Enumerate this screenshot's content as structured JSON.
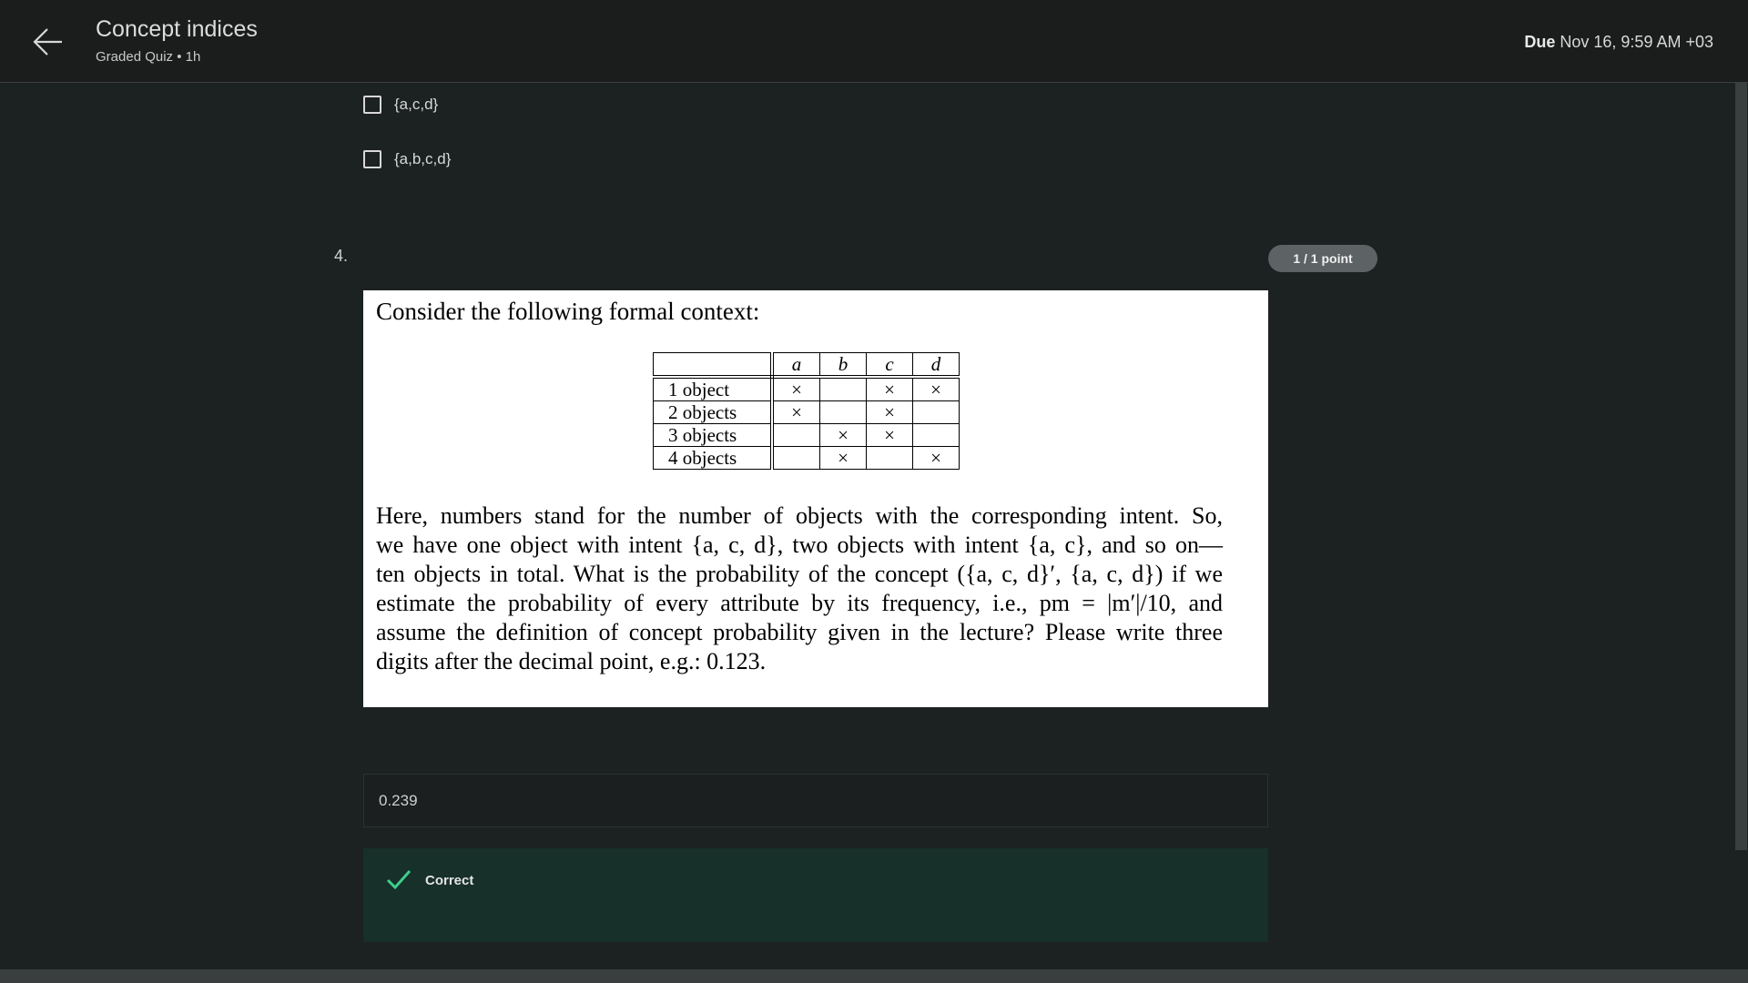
{
  "header": {
    "title": "Concept indices",
    "subtitle": "Graded Quiz • 1h",
    "due_label": "Due",
    "due_value": "Nov 16, 9:59 AM +03"
  },
  "prev_question": {
    "options": [
      {
        "label": "{a,c,d}",
        "checked": false
      },
      {
        "label": "{a,b,c,d}",
        "checked": false
      }
    ]
  },
  "question": {
    "number": "4.",
    "points": "1 / 1 point",
    "intro": "Consider the following formal context:",
    "table": {
      "columns": [
        "a",
        "b",
        "c",
        "d"
      ],
      "rows": [
        {
          "label": "1 object",
          "cells": [
            "×",
            "",
            "×",
            "×"
          ]
        },
        {
          "label": "2 objects",
          "cells": [
            "×",
            "",
            "×",
            ""
          ]
        },
        {
          "label": "3 objects",
          "cells": [
            "",
            "×",
            "×",
            ""
          ]
        },
        {
          "label": "4 objects",
          "cells": [
            "",
            "×",
            "",
            "×"
          ]
        }
      ]
    },
    "body_lines": [
      "Here, numbers stand for the number of objects with the corresponding intent. So,",
      "we have one object with intent {a, c, d}, two objects with intent {a, c}, and so on—",
      "ten objects in total. What is the probability of the concept ({a, c, d}′, {a, c, d}) if we",
      "estimate the probability of every attribute by its frequency, i.e., pm = |m′|/10, and",
      "assume the definition of concept probability given in the lecture? Please write three",
      "digits after the decimal point, e.g.: 0.123."
    ],
    "answer": "0.239",
    "feedback": "Correct"
  },
  "colors": {
    "background": "#1c2121",
    "header_bg": "#1b1d1d",
    "badge_bg": "#5d6264",
    "feedback_bg": "#173029",
    "check_green": "#3ccf8e"
  }
}
